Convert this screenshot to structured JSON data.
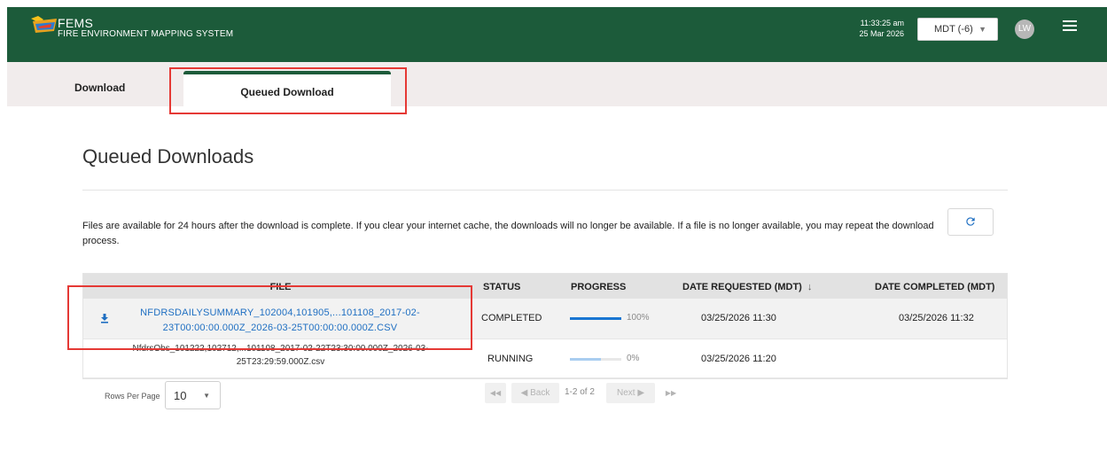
{
  "header": {
    "brand_name": "FEMS",
    "brand_subtitle": "FIRE ENVIRONMENT MAPPING SYSTEM",
    "time": "11:33:25 am",
    "date": "25 Mar 2026",
    "timezone": "MDT (-6)",
    "avatar_initials": "LW",
    "brand_color": "#1c5b3a"
  },
  "tabs": [
    {
      "label": "Download"
    },
    {
      "label": "Queued Download"
    }
  ],
  "page": {
    "title": "Queued Downloads",
    "info": "Files are available for 24 hours after the download is complete. If you clear your internet cache, the downloads will no longer be available. If a file is no longer available, you may repeat the download process."
  },
  "table": {
    "columns": {
      "file": "FILE",
      "status": "STATUS",
      "progress": "PROGRESS",
      "date_requested": "DATE REQUESTED (MDT)",
      "date_completed": "DATE COMPLETED (MDT)"
    },
    "sort_icon": "arrow-down-icon",
    "rows": [
      {
        "file_line1": "NFDRSDAILYSUMMARY_102004,101905,...101108_2017-02-",
        "file_line2": "23T00:00:00.000Z_2026-03-25T00:00:00.000Z.CSV",
        "status": "COMPLETED",
        "progress": 1.0,
        "progress_label": "100%",
        "progress_color": "#1976d2",
        "date_requested": "03/25/2026 11:30",
        "date_completed": "03/25/2026 11:32"
      },
      {
        "file_line1": "NfdrsObs_101222,102712,...101108_2017-02-22T23:30:00.000Z_2026-03-",
        "file_line2": "25T23:29:59.000Z.csv",
        "status": "RUNNING",
        "progress": 0.6,
        "progress_label": "0%",
        "progress_color": "#a9cdf0",
        "date_requested": "03/25/2026 11:20",
        "date_completed": ""
      }
    ]
  },
  "pagination": {
    "rows_per_page_label": "Rows Per Page",
    "rows_per_page": "10",
    "first": "◀◀",
    "back": "◀ Back",
    "info": "1-2 of 2",
    "next": "Next ▶",
    "last": "▶▶"
  },
  "highlight_color": "#e53935"
}
